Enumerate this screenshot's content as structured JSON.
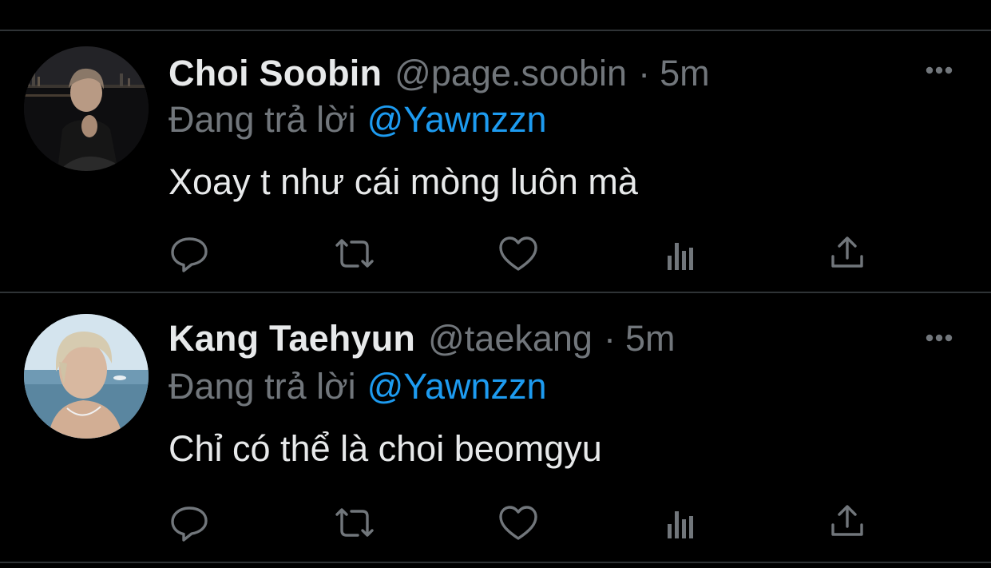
{
  "colors": {
    "background": "#000000",
    "divider": "#2f3336",
    "primary_text": "#e7e9ea",
    "secondary_text": "#71767b",
    "accent": "#1d9bf0"
  },
  "tweets": [
    {
      "display_name": "Choi Soobin",
      "handle": "@page.soobin",
      "separator": "·",
      "time": "5m",
      "reply_prefix": "Đang trả lời",
      "reply_to": "@Yawnzzn",
      "text": "Xoay t như cái mòng luôn mà",
      "actions": [
        "reply-icon",
        "retweet-icon",
        "like-icon",
        "views-icon",
        "share-icon"
      ]
    },
    {
      "display_name": "Kang Taehyun",
      "handle": "@taekang",
      "separator": "·",
      "time": "5m",
      "reply_prefix": "Đang trả lời",
      "reply_to": "@Yawnzzn",
      "text": "Chỉ có thể là choi beomgyu",
      "actions": [
        "reply-icon",
        "retweet-icon",
        "like-icon",
        "views-icon",
        "share-icon"
      ]
    }
  ]
}
